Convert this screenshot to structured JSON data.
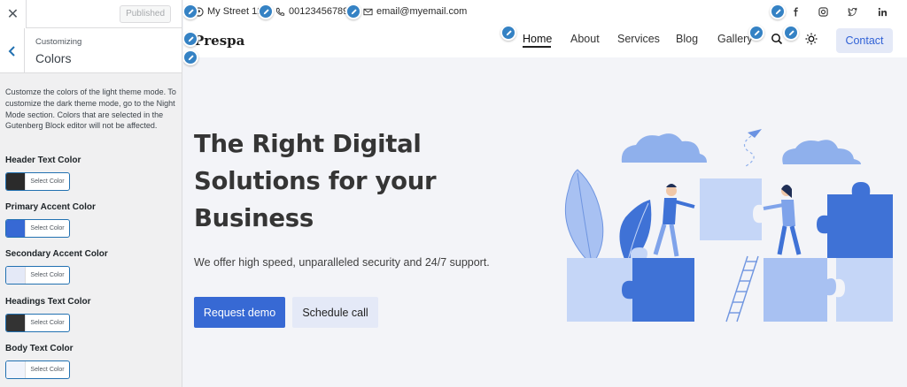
{
  "customizer": {
    "close_icon": "close-icon",
    "publish_label": "Published",
    "breadcrumb": "Customizing",
    "section_title": "Colors",
    "description": "Customze the colors of the light theme mode. To customize the dark theme mode, go to the Night Mode section. Colors that are selected in the Gutenberg Block editor will not be affected.",
    "controls": [
      {
        "label": "Header Text Color",
        "button": "Select Color",
        "swatch": "#2b2b2b"
      },
      {
        "label": "Primary Accent Color",
        "button": "Select Color",
        "swatch": "#3769d4"
      },
      {
        "label": "Secondary Accent Color",
        "button": "Select Color",
        "swatch": "#e4e9f7"
      },
      {
        "label": "Headings Text Color",
        "button": "Select Color",
        "swatch": "#333333"
      },
      {
        "label": "Body Text Color",
        "button": "Select Color",
        "swatch": "#f0f3fb"
      }
    ]
  },
  "site": {
    "topbar": {
      "address": "My Street 12",
      "phone": "001234567890",
      "email": "email@myemail.com",
      "social_icons": [
        "facebook-icon",
        "instagram-icon",
        "twitter-icon",
        "linkedin-icon"
      ]
    },
    "logo": "Prespa",
    "nav": [
      "Home",
      "About",
      "Services",
      "Blog",
      "Gallery"
    ],
    "contact_label": "Contact",
    "hero": {
      "title": "The Right Digital Solutions for your Business",
      "subtitle": "We offer high speed, unparalleled security and 24/7 support.",
      "primary_button": "Request demo",
      "secondary_button": "Schedule call"
    }
  },
  "colors": {
    "accent": "#3769d4",
    "accent_light": "#e4e9f7",
    "illustration_blue": "#3f72d6",
    "illustration_light": "#c5d6f7",
    "illustration_mid": "#8fb0ec"
  }
}
